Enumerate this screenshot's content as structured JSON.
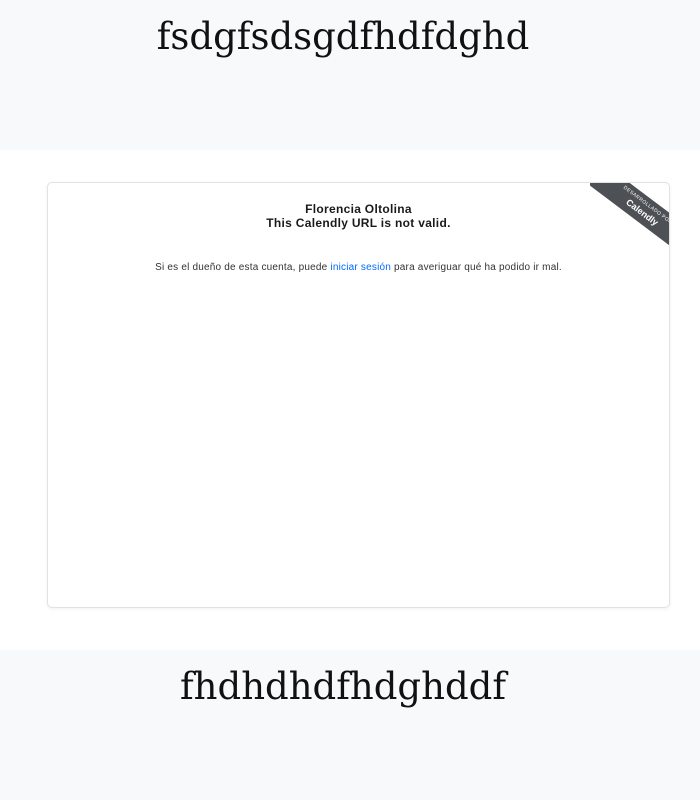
{
  "top_heading": "fsdgfsdsgdfhdfdghd",
  "calendly_embed": {
    "owner_name": "Florencia Oltolina",
    "error_message": "This Calendly URL is not valid.",
    "help_prefix": "Si es el dueño de esta cuenta, puede ",
    "login_link": "iniciar sesión",
    "help_suffix": " para averiguar qué ha podido ir mal.",
    "badge_small": "DESARROLLADO POR",
    "badge_brand": "Calendly",
    "link_color": "#0069ff",
    "badge_color": "#4d5055"
  },
  "bottom_heading": "fhdhdhdfhdghddf"
}
